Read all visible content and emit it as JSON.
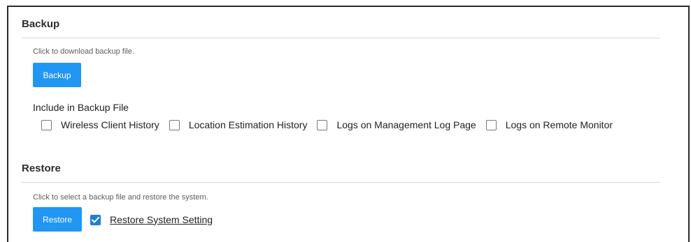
{
  "backup": {
    "title": "Backup",
    "hint": "Click to download backup file.",
    "button_label": "Backup",
    "include_label": "Include in Backup File",
    "options": [
      {
        "label": "Wireless Client History",
        "checked": false
      },
      {
        "label": "Location Estimation History",
        "checked": false
      },
      {
        "label": "Logs on Management Log Page",
        "checked": false
      },
      {
        "label": "Logs on Remote Monitor",
        "checked": false
      }
    ]
  },
  "restore": {
    "title": "Restore",
    "hint": "Click to select a backup file and restore the system.",
    "button_label": "Restore",
    "option": {
      "label": "Restore System Setting",
      "checked": true
    }
  },
  "colors": {
    "button": "#2196f3",
    "checkbox_checked": "#1d7fd6"
  }
}
